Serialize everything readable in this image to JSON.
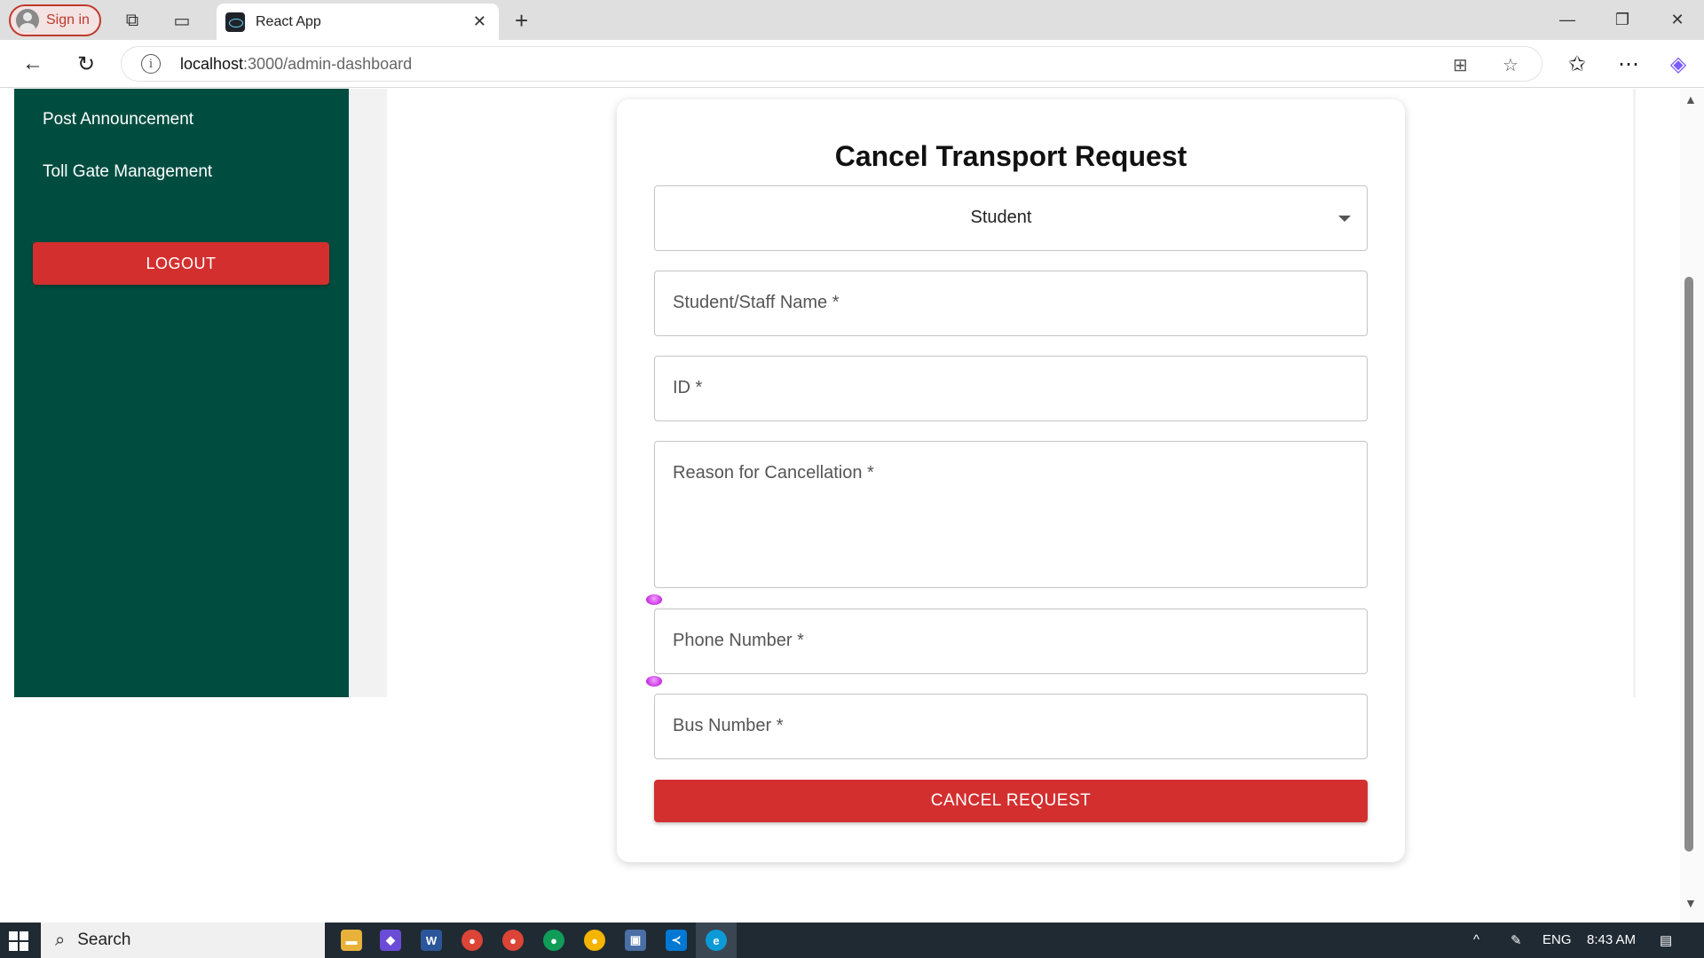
{
  "browser": {
    "signin_label": "Sign in",
    "tab_title": "React App",
    "url_host": "localhost",
    "url_path": ":3000/admin-dashboard"
  },
  "sidebar": {
    "items": [
      {
        "label": "Post Announcement"
      },
      {
        "label": "Toll Gate Management"
      }
    ],
    "logout_label": "LOGOUT"
  },
  "form": {
    "title": "Cancel Transport Request",
    "select_value": "Student",
    "fields": {
      "name_label": "Student/Staff Name *",
      "id_label": "ID *",
      "reason_label": "Reason for Cancellation *",
      "phone_label": "Phone Number *",
      "bus_label": "Bus Number *"
    },
    "submit_label": "CANCEL REQUEST"
  },
  "taskbar": {
    "search_label": "Search",
    "language": "ENG",
    "time": "8:43 AM"
  }
}
